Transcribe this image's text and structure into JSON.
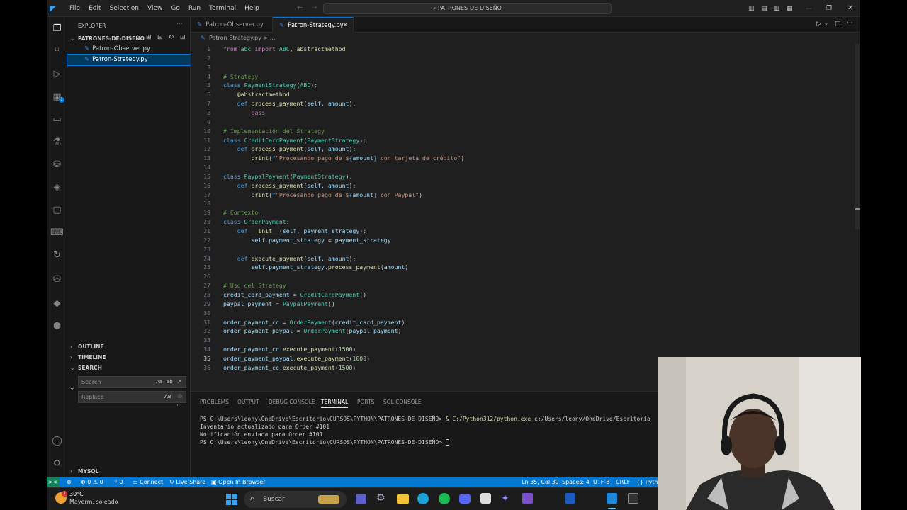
{
  "titlebar": {
    "menu": [
      "File",
      "Edit",
      "Selection",
      "View",
      "Go",
      "Run",
      "Terminal",
      "Help"
    ],
    "search_text": "PATRONES-DE-DISEÑO"
  },
  "sidebar": {
    "header": "EXPLORER",
    "folder": "PATRONES-DE-DISEÑO",
    "files": [
      {
        "name": "Patron-Observer.py",
        "selected": false
      },
      {
        "name": "Patron-Strategy.py",
        "selected": true
      }
    ],
    "sections": {
      "outline": "OUTLINE",
      "timeline": "TIMELINE",
      "search": "SEARCH",
      "mysql": "MYSQL"
    },
    "search_placeholder": "Search",
    "replace_placeholder": "Replace",
    "search_opts": "Aa",
    "replace_opt": "AB"
  },
  "tabs": [
    {
      "label": "Patron-Observer.py",
      "active": false
    },
    {
      "label": "Patron-Strategy.py",
      "active": true
    }
  ],
  "breadcrumb": "Patron-Strategy.py  >  ...",
  "editor": {
    "current_line": 35,
    "lines": [
      [
        [
          "from ",
          "ctrl"
        ],
        [
          "abc ",
          "cls"
        ],
        [
          "import ",
          "ctrl"
        ],
        [
          "ABC",
          "cls"
        ],
        [
          ", ",
          ""
        ],
        [
          "abstractmethod",
          "fn"
        ]
      ],
      [],
      [],
      [
        [
          "# Strategy",
          "cmt"
        ]
      ],
      [
        [
          "class ",
          "kw"
        ],
        [
          "PaymentStrategy",
          "cls"
        ],
        [
          "(",
          ""
        ],
        [
          "ABC",
          "cls"
        ],
        [
          "):",
          ""
        ]
      ],
      [
        [
          "    ",
          ""
        ],
        [
          "@abstractmethod",
          "dec"
        ]
      ],
      [
        [
          "    ",
          ""
        ],
        [
          "def ",
          "kw"
        ],
        [
          "process_payment",
          "fn"
        ],
        [
          "(",
          ""
        ],
        [
          "self",
          "var"
        ],
        [
          ", ",
          ""
        ],
        [
          "amount",
          "var"
        ],
        [
          "):",
          ""
        ]
      ],
      [
        [
          "        ",
          ""
        ],
        [
          "pass",
          "ctrl"
        ]
      ],
      [],
      [
        [
          "# Implementación del Strategy",
          "cmt"
        ]
      ],
      [
        [
          "class ",
          "kw"
        ],
        [
          "CreditCardPayment",
          "cls"
        ],
        [
          "(",
          ""
        ],
        [
          "PaymentStrategy",
          "cls"
        ],
        [
          "):",
          ""
        ]
      ],
      [
        [
          "    ",
          ""
        ],
        [
          "def ",
          "kw"
        ],
        [
          "process_payment",
          "fn"
        ],
        [
          "(",
          ""
        ],
        [
          "self",
          "var"
        ],
        [
          ", ",
          ""
        ],
        [
          "amount",
          "var"
        ],
        [
          "):",
          ""
        ]
      ],
      [
        [
          "        ",
          ""
        ],
        [
          "print",
          "fn"
        ],
        [
          "(",
          ""
        ],
        [
          "f",
          "kw"
        ],
        [
          "\"Procesando pago de $",
          "str"
        ],
        [
          "{",
          "kw"
        ],
        [
          "amount",
          "var"
        ],
        [
          "}",
          "kw"
        ],
        [
          " con tarjeta de crédito\"",
          "str"
        ],
        [
          ")",
          ""
        ]
      ],
      [],
      [
        [
          "class ",
          "kw"
        ],
        [
          "PaypalPayment",
          "cls"
        ],
        [
          "(",
          ""
        ],
        [
          "PaymentStrategy",
          "cls"
        ],
        [
          "):",
          ""
        ]
      ],
      [
        [
          "    ",
          ""
        ],
        [
          "def ",
          "kw"
        ],
        [
          "process_payment",
          "fn"
        ],
        [
          "(",
          ""
        ],
        [
          "self",
          "var"
        ],
        [
          ", ",
          ""
        ],
        [
          "amount",
          "var"
        ],
        [
          "):",
          ""
        ]
      ],
      [
        [
          "        ",
          ""
        ],
        [
          "print",
          "fn"
        ],
        [
          "(",
          ""
        ],
        [
          "f",
          "kw"
        ],
        [
          "\"Procesando pago de $",
          "str"
        ],
        [
          "{",
          "kw"
        ],
        [
          "amount",
          "var"
        ],
        [
          "}",
          "kw"
        ],
        [
          " con Paypal\"",
          "str"
        ],
        [
          ")",
          ""
        ]
      ],
      [],
      [
        [
          "# Contexto",
          "cmt"
        ]
      ],
      [
        [
          "class ",
          "kw"
        ],
        [
          "OrderPayment",
          "cls"
        ],
        [
          ":",
          ""
        ]
      ],
      [
        [
          "    ",
          ""
        ],
        [
          "def ",
          "kw"
        ],
        [
          "__init__",
          "fn"
        ],
        [
          "(",
          ""
        ],
        [
          "self",
          "var"
        ],
        [
          ", ",
          ""
        ],
        [
          "payment_strategy",
          "var"
        ],
        [
          "):",
          ""
        ]
      ],
      [
        [
          "        ",
          ""
        ],
        [
          "self",
          "var"
        ],
        [
          ".",
          ""
        ],
        [
          "payment_strategy",
          "var"
        ],
        [
          " = ",
          ""
        ],
        [
          "payment_strategy",
          "var"
        ]
      ],
      [],
      [
        [
          "    ",
          ""
        ],
        [
          "def ",
          "kw"
        ],
        [
          "execute_payment",
          "fn"
        ],
        [
          "(",
          ""
        ],
        [
          "self",
          "var"
        ],
        [
          ", ",
          ""
        ],
        [
          "amount",
          "var"
        ],
        [
          "):",
          ""
        ]
      ],
      [
        [
          "        ",
          ""
        ],
        [
          "self",
          "var"
        ],
        [
          ".",
          ""
        ],
        [
          "payment_strategy",
          "var"
        ],
        [
          ".",
          ""
        ],
        [
          "process_payment",
          "fn"
        ],
        [
          "(",
          ""
        ],
        [
          "amount",
          "var"
        ],
        [
          ")",
          ""
        ]
      ],
      [],
      [
        [
          "# Uso del Strategy",
          "cmt"
        ]
      ],
      [
        [
          "credit_card_payment",
          "var"
        ],
        [
          " = ",
          ""
        ],
        [
          "CreditCardPayment",
          "cls"
        ],
        [
          "()",
          ""
        ]
      ],
      [
        [
          "paypal_payment",
          "var"
        ],
        [
          " = ",
          ""
        ],
        [
          "PaypalPayment",
          "cls"
        ],
        [
          "()",
          ""
        ]
      ],
      [],
      [
        [
          "order_payment_cc",
          "var"
        ],
        [
          " = ",
          ""
        ],
        [
          "OrderPayment",
          "cls"
        ],
        [
          "(",
          ""
        ],
        [
          "credit_card_payment",
          "var"
        ],
        [
          ")",
          ""
        ]
      ],
      [
        [
          "order_payment_paypal",
          "var"
        ],
        [
          " = ",
          ""
        ],
        [
          "OrderPayment",
          "cls"
        ],
        [
          "(",
          ""
        ],
        [
          "paypal_payment",
          "var"
        ],
        [
          ")",
          ""
        ]
      ],
      [],
      [
        [
          "order_payment_cc",
          "var"
        ],
        [
          ".",
          ""
        ],
        [
          "execute_payment",
          "fn"
        ],
        [
          "(",
          ""
        ],
        [
          "1500",
          "num"
        ],
        [
          ")",
          ""
        ]
      ],
      [
        [
          "order_payment_paypal",
          "var"
        ],
        [
          ".",
          ""
        ],
        [
          "execute_payment",
          "fn"
        ],
        [
          "(",
          ""
        ],
        [
          "1000",
          "num"
        ],
        [
          ")",
          ""
        ]
      ],
      [
        [
          "order_payment_cc",
          "var"
        ],
        [
          ".",
          ""
        ],
        [
          "execute_payment",
          "fn"
        ],
        [
          "(",
          ""
        ],
        [
          "1500",
          "num"
        ],
        [
          ")",
          ""
        ]
      ]
    ]
  },
  "panel": {
    "tabs": [
      "PROBLEMS",
      "OUTPUT",
      "DEBUG CONSOLE",
      "TERMINAL",
      "PORTS",
      "SQL CONSOLE"
    ],
    "active_tab": "TERMINAL",
    "terminal": [
      {
        "prompt": "PS C:\\Users\\leony\\OneDrive\\Escritorio\\CURSOS\\PYTHON\\PATRONES-DE-DISEÑO> ",
        "cmd": "& C:/Python312/python.exe",
        "rest": " c:/Users/leony/OneDrive/Escritorio"
      },
      {
        "text": "Inventario actualizado para Order #101"
      },
      {
        "text": "Notificación enviada para Order #101"
      },
      {
        "prompt": "PS C:\\Users\\leony\\OneDrive\\Escritorio\\CURSOS\\PYTHON\\PATRONES-DE-DISEÑO> ",
        "cmd": "",
        "rest": ""
      }
    ]
  },
  "statusbar": {
    "remote": "><",
    "errors": "⊗ 0",
    "warnings": "⚠ 0",
    "ports": "0",
    "connect": "Connect",
    "liveshare": "Live Share",
    "browser": "Open In Browser",
    "position": "Ln 35, Col 39",
    "spaces": "Spaces: 4",
    "encoding": "UTF-8",
    "eol": "CRLF",
    "lang": "Pyth"
  },
  "taskbar": {
    "weather_temp": "30°C",
    "weather_desc": "Mayorm. soleado",
    "search": "Buscar",
    "badge": "1"
  },
  "colors": {
    "accent": "#0078d4",
    "editor_bg": "#1f1f1f",
    "sidebar_bg": "#181818"
  }
}
